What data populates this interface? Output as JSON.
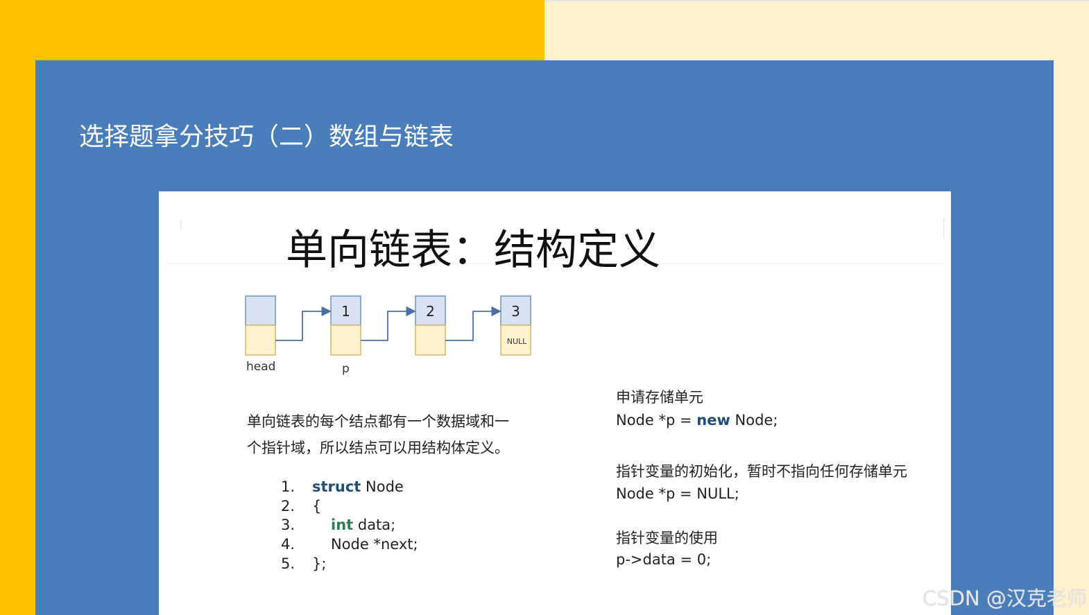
{
  "slide": {
    "title": "选择题拿分技巧（二）数组与链表"
  },
  "card": {
    "title": "单向链表：结构定义",
    "diagram": {
      "nodes": [
        {
          "value": "",
          "next": ""
        },
        {
          "value": "1",
          "next": ""
        },
        {
          "value": "2",
          "next": ""
        },
        {
          "value": "3",
          "next": "NULL"
        }
      ],
      "labels": {
        "head": "head",
        "p": "p"
      }
    },
    "description": [
      "单向链表的每个结点都有一个数据域和一",
      "个指针域，所以结点可以用结构体定义。"
    ],
    "code": {
      "line1": {
        "num": "1.",
        "kw": "struct",
        "rest": " Node"
      },
      "line2": {
        "num": "2.",
        "text": "{"
      },
      "line3": {
        "num": "3.",
        "kw": "int",
        "rest": " data;"
      },
      "line4": {
        "num": "4.",
        "text": "Node *next;"
      },
      "line5": {
        "num": "5.",
        "text": "};"
      }
    },
    "right": {
      "alloc_heading": "申请存储单元",
      "alloc_code_pre": "Node *p = ",
      "alloc_code_kw": "new",
      "alloc_code_post": " Node;",
      "init_heading": "指针变量的初始化，暂时不指向任何存储单元",
      "init_code": "Node *p = NULL;",
      "use_heading": "指针变量的使用",
      "use_code": "p->data = 0;"
    }
  },
  "watermark": "CSDN @汉克老师",
  "colors": {
    "yellow": "#ffc000",
    "cream": "#fff2cc",
    "blue": "#4a7ebb",
    "node_top": "#dae3f3",
    "node_bottom": "#fff2cc",
    "node_border": "#6f8fbf",
    "arrow": "#4a6fa5"
  }
}
